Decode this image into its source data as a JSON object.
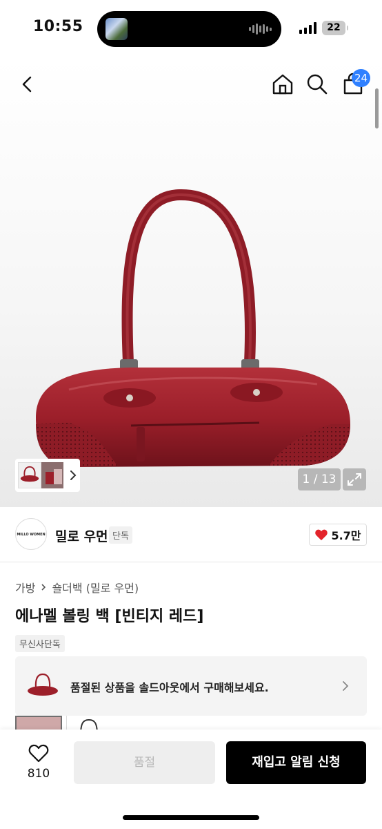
{
  "status_bar": {
    "time": "10:55",
    "battery": "22"
  },
  "nav": {
    "cart_count": "24"
  },
  "gallery": {
    "counter": "1 / 13"
  },
  "brand": {
    "logo_text": "MILLO WOMEN",
    "name": "밀로 우먼",
    "tag": "단독",
    "likes": "5.7만"
  },
  "product": {
    "breadcrumb": [
      "가방",
      "숄더백 (밀로 우먼)"
    ],
    "title": "에나멜 볼링 백 [빈티지 레드]",
    "exclusive_badge": "무신사단독",
    "soldout_notice": "품절된 상품을 솔드아웃에서 구매해보세요."
  },
  "bottom_bar": {
    "wish_count": "810",
    "soldout_label": "품절",
    "restock_label": "재입고 알림 신청"
  },
  "colors": {
    "accent_blue": "#2f80ff",
    "bag_red": "#9c1f2a",
    "heart_red": "#e3242b"
  }
}
